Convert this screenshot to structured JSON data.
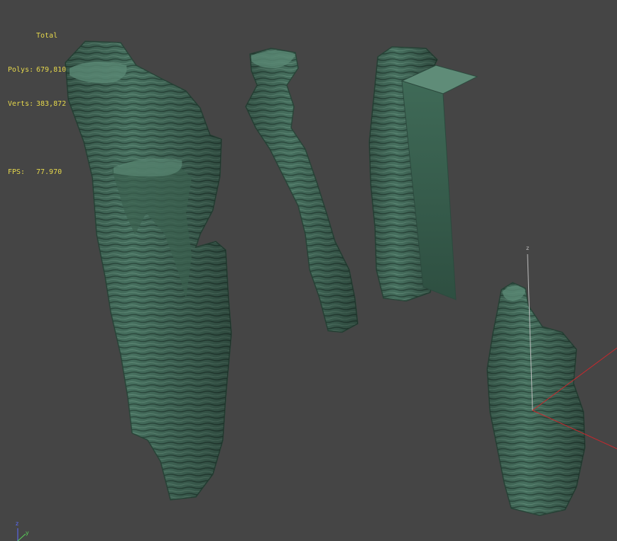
{
  "viewport": {
    "background": "#454545",
    "stats": {
      "total_label": "Total",
      "polys_label": "Polys:",
      "polys_value": "679,810",
      "verts_label": "Verts:",
      "verts_value": "383,872",
      "fps_label": "FPS:",
      "fps_value": "77.970",
      "text_color": "#e6d84c"
    },
    "gizmo": {
      "z_label": "z",
      "colors": {
        "x": "#c8282d",
        "z": "#bfbfbf"
      }
    },
    "corner_axis": {
      "z_label": "z",
      "y_label": "y",
      "colors": {
        "z": "#5a6cff",
        "y": "#5ad35a"
      }
    },
    "rock_color": "#4a7563"
  }
}
